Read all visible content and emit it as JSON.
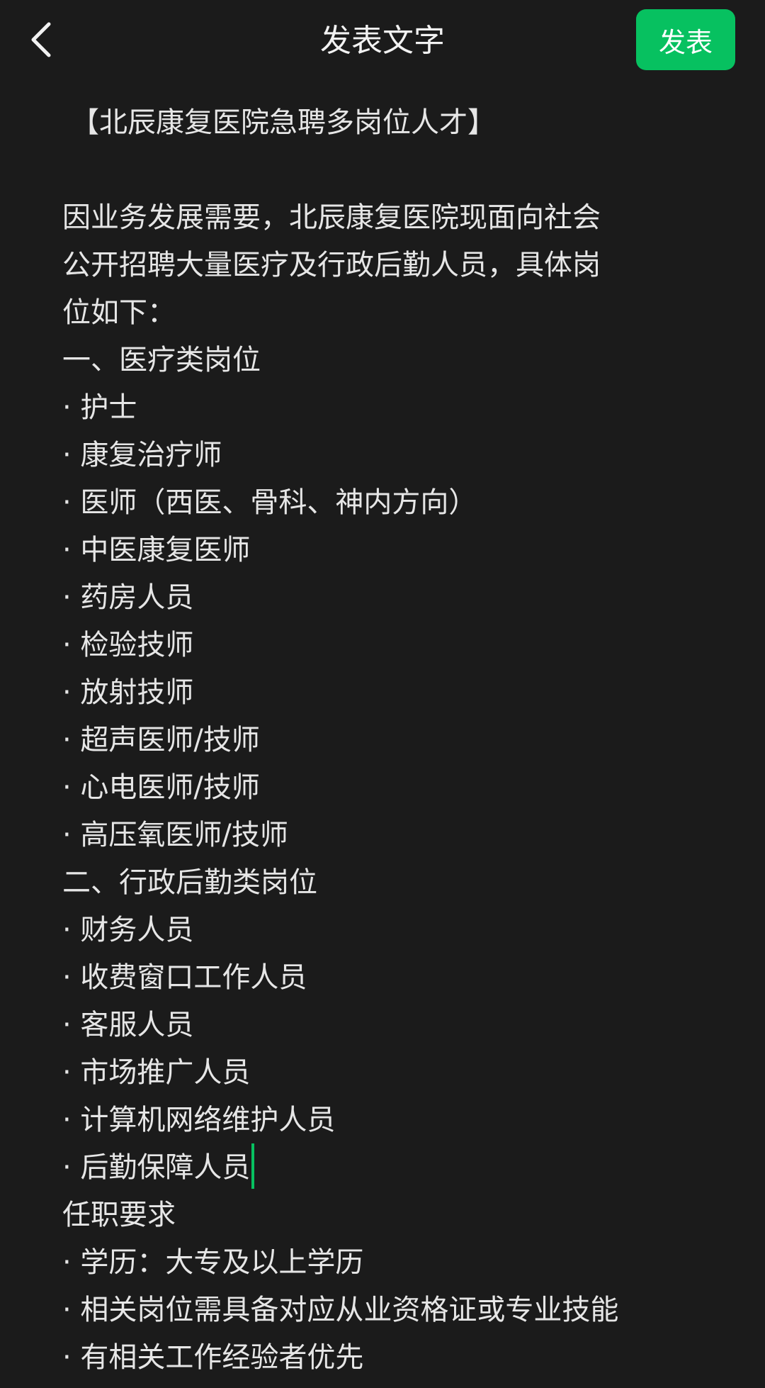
{
  "header": {
    "title": "发表文字",
    "publish_label": "发表"
  },
  "colors": {
    "background": "#1b1b1b",
    "accent": "#07c160",
    "text": "#e6e6e6"
  },
  "icons": {
    "back": "chevron-left-icon"
  },
  "editor": {
    "lines": [
      "【北辰康复医院急聘多岗位人才】",
      "",
      "因业务发展需要，北辰康复医院现面向社会",
      "公开招聘大量医疗及行政后勤人员，具体岗",
      "位如下：",
      "一、医疗类岗位",
      "· 护士",
      "· 康复治疗师",
      "· 医师（西医、骨科、神内方向）",
      "· 中医康复医师",
      "· 药房人员",
      "· 检验技师",
      "· 放射技师",
      "· 超声医师/技师",
      "· 心电医师/技师",
      "· 高压氧医师/技师",
      "二、行政后勤类岗位",
      "· 财务人员",
      "· 收费窗口工作人员",
      "· 客服人员",
      "· 市场推广人员",
      "· 计算机网络维护人员",
      "· 后勤保障人员",
      "任职要求",
      "· 学历：大专及以上学历",
      "· 相关岗位需具备对应从业资格证或专业技能",
      "· 有相关工作经验者优先"
    ]
  }
}
